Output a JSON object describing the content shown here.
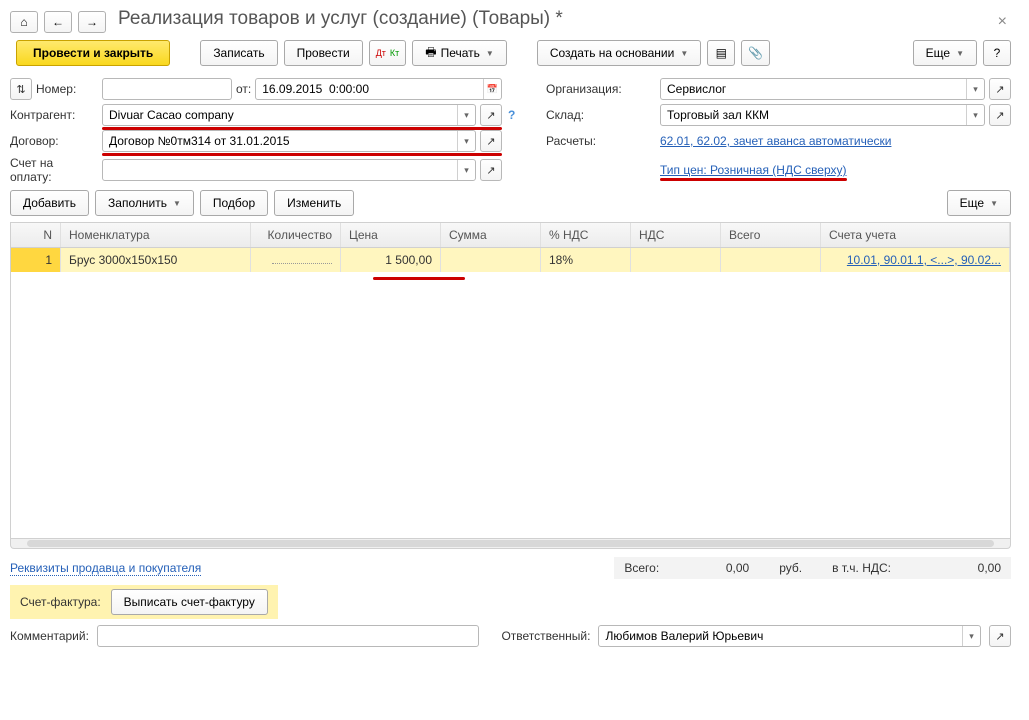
{
  "header": {
    "title": "Реализация товаров и услуг (создание) (Товары) *"
  },
  "toolbar": {
    "post_close": "Провести и закрыть",
    "save": "Записать",
    "post": "Провести",
    "print": "Печать",
    "create_based": "Создать на основании",
    "more": "Еще"
  },
  "fields": {
    "number_label": "Номер:",
    "number_value": "",
    "from_label": "от:",
    "date_value": "16.09.2015  0:00:00",
    "org_label": "Организация:",
    "org_value": "Сервислог",
    "contr_label": "Контрагент:",
    "contr_value": "Divuar Cacao company",
    "dogovor_label": "Договор:",
    "dogovor_value": "Договор №0тм314 от 31.01.2015",
    "sklad_label": "Склад:",
    "sklad_value": "Торговый зал ККМ",
    "raschety_label": "Расчеты:",
    "raschety_link": "62.01, 62.02, зачет аванса автоматически",
    "schet_label": "Счет на оплату:",
    "schet_value": "",
    "price_type_link": "Тип цен: Розничная (НДС сверху)"
  },
  "table_toolbar": {
    "add": "Добавить",
    "fill": "Заполнить",
    "pick": "Подбор",
    "edit": "Изменить",
    "more": "Еще"
  },
  "table": {
    "headers": {
      "n": "N",
      "nom": "Номенклатура",
      "qty": "Количество",
      "price": "Цена",
      "sum": "Сумма",
      "vatp": "% НДС",
      "vat": "НДС",
      "total": "Всего",
      "acc": "Счета учета"
    },
    "rows": [
      {
        "n": "1",
        "nom": "Брус 3000х150х150",
        "qty": "",
        "price": "1 500,00",
        "sum": "",
        "vatp": "18%",
        "vat": "",
        "total": "",
        "acc": "10.01, 90.01.1, <...>, 90.02..."
      }
    ]
  },
  "footer": {
    "rekv_link": "Реквизиты продавца и покупателя",
    "total_label": "Всего:",
    "total_value": "0,00",
    "currency": "руб.",
    "vat_incl_label": "в т.ч. НДС:",
    "vat_incl_value": "0,00",
    "invoice_label": "Счет-фактура:",
    "invoice_btn": "Выписать счет-фактуру",
    "comment_label": "Комментарий:",
    "comment_value": "",
    "resp_label": "Ответственный:",
    "resp_value": "Любимов Валерий Юрьевич"
  }
}
